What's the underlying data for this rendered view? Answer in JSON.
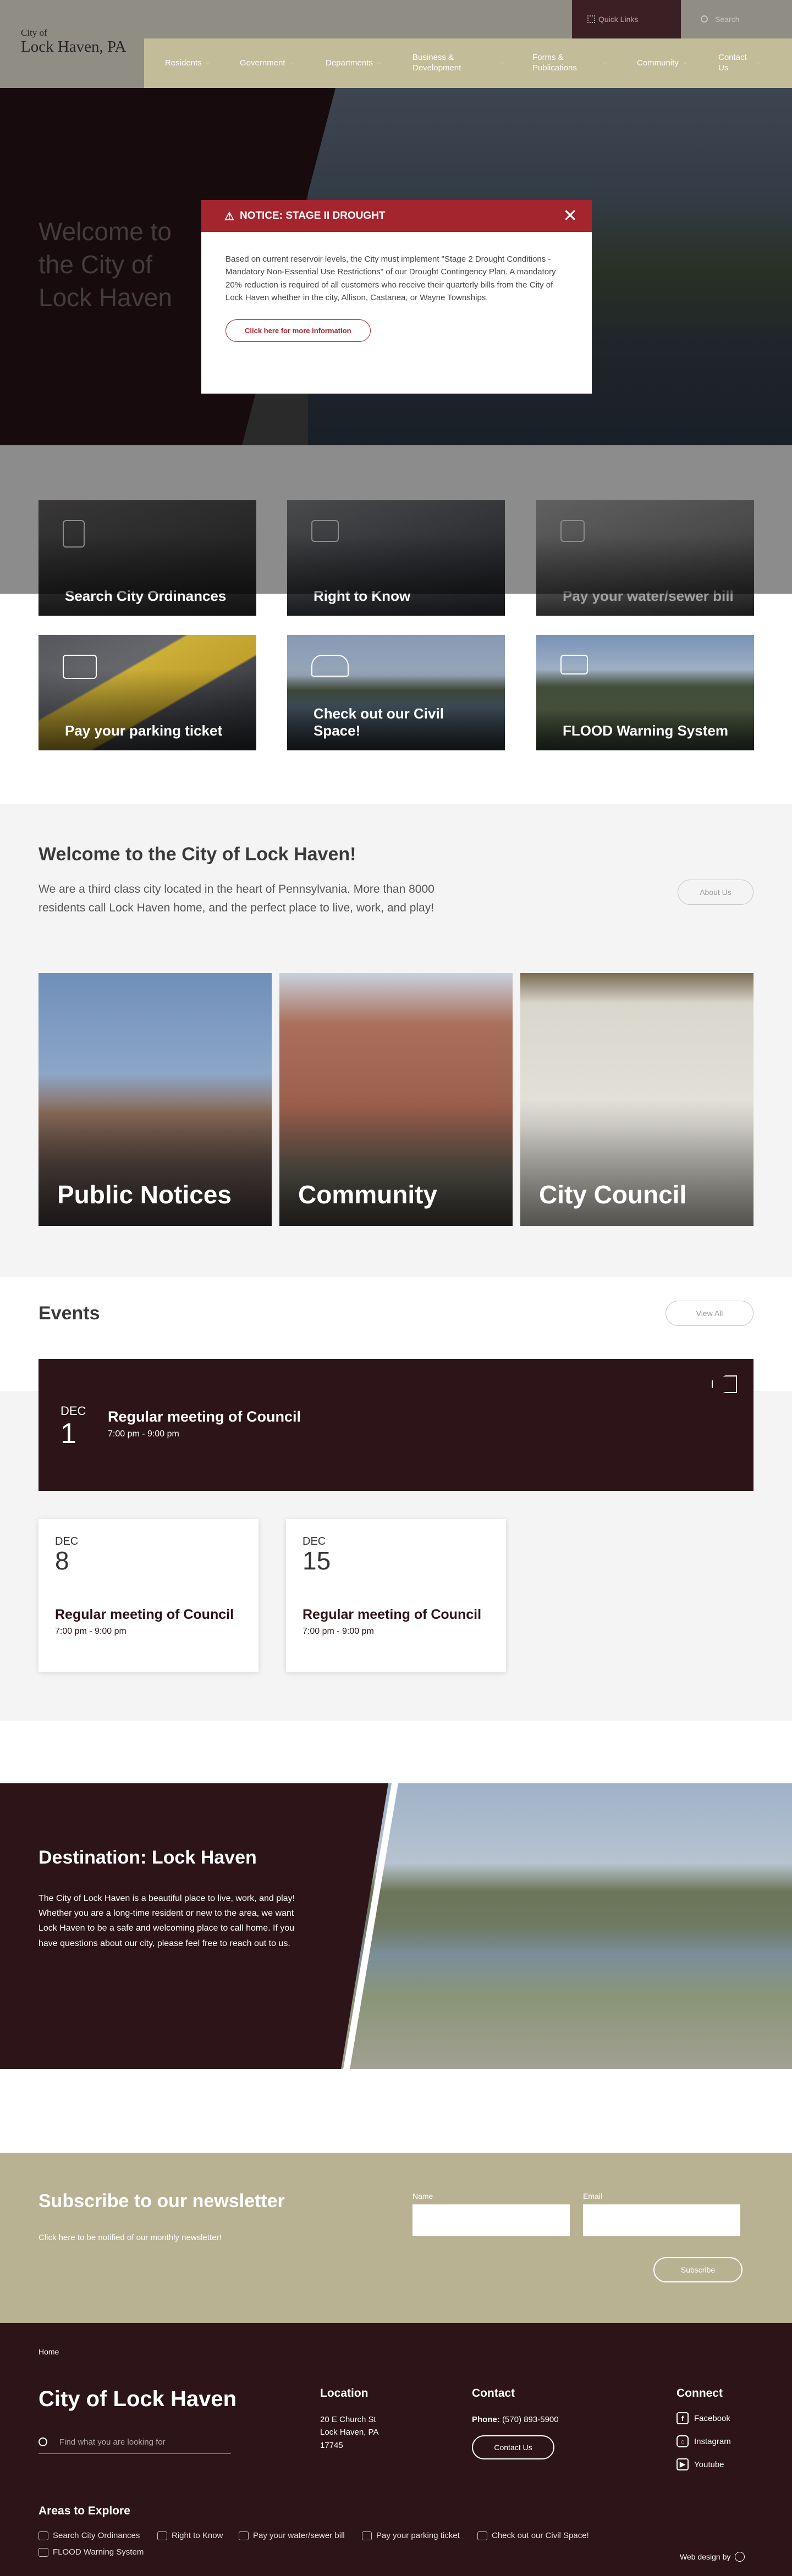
{
  "header": {
    "logo_small": "City of",
    "logo_big": "Lock Haven, PA",
    "quick_links": "Quick Links",
    "search_placeholder": "Search",
    "nav": [
      {
        "label": "Residents"
      },
      {
        "label": "Government"
      },
      {
        "label": "Departments"
      },
      {
        "label": "Business & Development"
      },
      {
        "label": "Forms & Publications"
      },
      {
        "label": "Community"
      },
      {
        "label": "Contact Us"
      }
    ]
  },
  "hero": {
    "title": "Welcome to the City of Lock Haven"
  },
  "modal": {
    "title": "NOTICE: STAGE II DROUGHT",
    "body": "Based on current reservoir levels, the City must implement \"Stage 2 Drought Conditions - Mandatory Non-Essential Use Restrictions\" of our Drought Contingency Plan. A mandatory 20% reduction is required of all customers who receive their quarterly bills from the City of Lock Haven whether in the city, Allison, Castanea, or Wayne Townships.",
    "button": "Click here for more information"
  },
  "tiles": [
    {
      "label": "Search City Ordinances"
    },
    {
      "label": "Right to Know"
    },
    {
      "label": "Pay your water/sewer bill"
    },
    {
      "label": "Pay your parking ticket"
    },
    {
      "label": "Check out our Civil Space!"
    },
    {
      "label": "FLOOD Warning System"
    }
  ],
  "welcome": {
    "title": "Welcome to the City of Lock Haven!",
    "text": "We are a third class city located in the heart of Pennsylvania. More than 8000 residents call Lock Haven home, and the perfect place to live, work, and play!",
    "button": "About Us",
    "cards": [
      {
        "label": "Public Notices"
      },
      {
        "label": "Community"
      },
      {
        "label": "City Council"
      }
    ]
  },
  "events": {
    "title": "Events",
    "view_all": "View All",
    "featured": {
      "month": "DEC",
      "day": "1",
      "name": "Regular meeting of Council",
      "time": "7:00 pm - 9:00 pm"
    },
    "items": [
      {
        "month": "DEC",
        "day": "8",
        "name": "Regular meeting of Council",
        "time": "7:00 pm - 9:00 pm"
      },
      {
        "month": "DEC",
        "day": "15",
        "name": "Regular meeting of Council",
        "time": "7:00 pm - 9:00 pm"
      }
    ]
  },
  "destination": {
    "title": "Destination: Lock Haven",
    "text": "The City of Lock Haven is a beautiful place to live, work, and play! Whether you are a long-time resident or new to the area, we want Lock Haven to be a safe and welcoming place to call home. If you have questions about our city, please feel free to reach out to us."
  },
  "newsletter": {
    "title": "Subscribe to our newsletter",
    "subtitle": "Click here to be notified of our monthly newsletter!",
    "name_label": "Name",
    "email_label": "Email",
    "button": "Subscribe"
  },
  "footer": {
    "breadcrumb": "Home",
    "title": "City of Lock Haven",
    "search_placeholder": "Find what you are looking for",
    "location_head": "Location",
    "address_1": "20 E Church St",
    "address_2": "Lock Haven, PA",
    "address_3": "17745",
    "contact_head": "Contact",
    "phone_label": "Phone:",
    "phone": "(570) 893-5900",
    "contact_button": "Contact Us",
    "connect_head": "Connect",
    "social": [
      {
        "label": "Facebook"
      },
      {
        "label": "Instagram"
      },
      {
        "label": "Youtube"
      }
    ],
    "areas_head": "Areas to Explore",
    "areas": [
      {
        "label": "Search City Ordinances"
      },
      {
        "label": "Right to Know"
      },
      {
        "label": "Pay your water/sewer bill"
      },
      {
        "label": "Pay your parking ticket"
      },
      {
        "label": "Check out our Civil Space!"
      },
      {
        "label": "FLOOD Warning System"
      }
    ],
    "credit": "Web design by"
  }
}
